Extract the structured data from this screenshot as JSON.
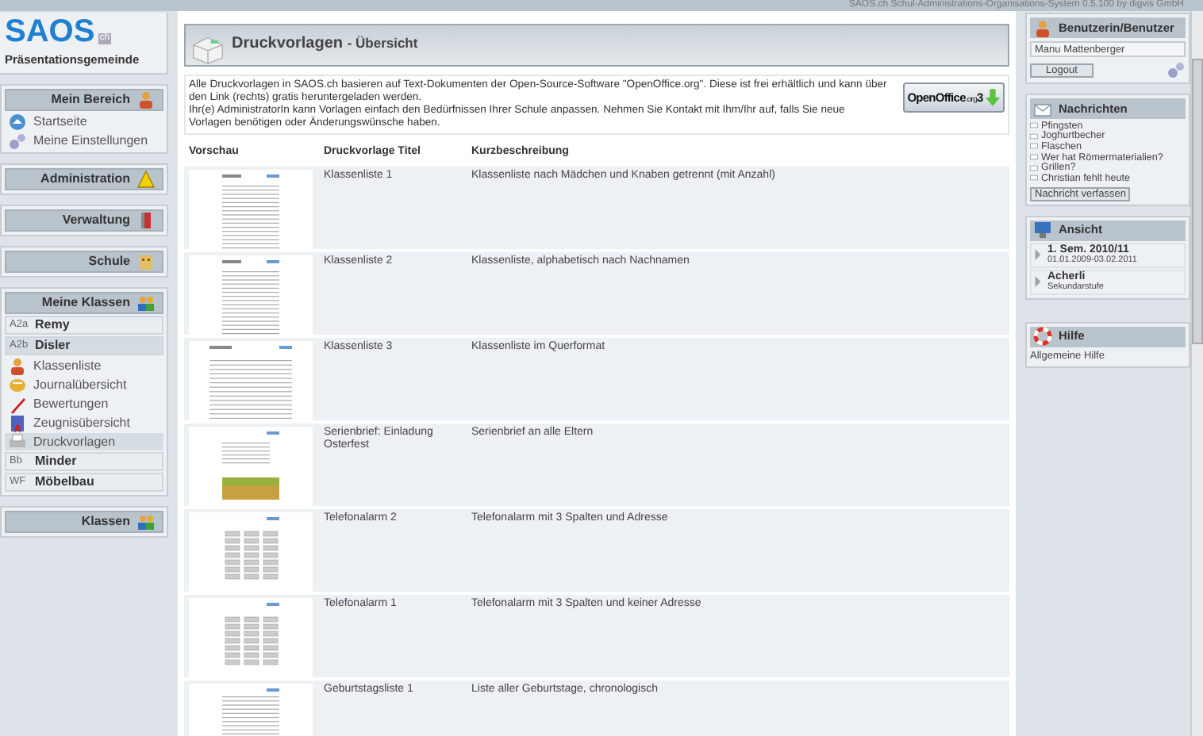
{
  "top_bar": {
    "text": "SAOS.ch Schul-Administrations-Organisations-System 0.5.100 by digvis GmbH"
  },
  "logo": {
    "name": "SAOS",
    "suffix": "ch",
    "school": "Präsentationsgemeinde"
  },
  "sidebar": {
    "sections": [
      {
        "title": "Mein Bereich",
        "items": [
          {
            "label": "Startseite"
          },
          {
            "label": "Meine Einstellungen"
          }
        ]
      },
      {
        "title": "Administration"
      },
      {
        "title": "Verwaltung"
      },
      {
        "title": "Schule"
      },
      {
        "title": "Meine Klassen",
        "classes": [
          {
            "code": "A2a",
            "name": "Remy",
            "expanded": false
          },
          {
            "code": "A2b",
            "name": "Disler",
            "expanded": true,
            "children": [
              {
                "label": "Klassenliste",
                "selected": false
              },
              {
                "label": "Journalübersicht",
                "selected": false
              },
              {
                "label": "Bewertungen",
                "selected": false
              },
              {
                "label": "Zeugnisübersicht",
                "selected": false
              },
              {
                "label": "Druckvorlagen",
                "selected": true
              }
            ]
          },
          {
            "code": "Bb",
            "name": "Minder",
            "expanded": false
          },
          {
            "code": "WF",
            "name": "Möbelbau",
            "expanded": false
          }
        ]
      },
      {
        "title": "Klassen"
      }
    ]
  },
  "page": {
    "title": "Druckvorlagen",
    "subtitle": "- Übersicht",
    "intro": [
      "Alle Druckvorlagen in SAOS.ch basieren auf Text-Dokumenten der Open-Source-Software \"OpenOffice.org\". Diese ist frei erhältlich und kann über den Link (rechts) gratis heruntergeladen werden.",
      "Ihr(e) AdministratorIn kann Vorlagen einfach den Bedürfnissen Ihrer Schule anpassen. Nehmen Sie Kontakt mit Ihm/Ihr auf, falls Sie neue Vorlagen benötigen oder Änderungswünsche haben."
    ],
    "download": {
      "brand": "OpenOffice",
      "org": ".org",
      "version": "3"
    },
    "table": {
      "columns": [
        "Vorschau",
        "Druckvorlage Titel",
        "Kurzbeschreibung"
      ],
      "rows": [
        {
          "kind": "table",
          "title": "Klassenliste 1",
          "description": "Klassenliste nach Mädchen und Knaben getrennt (mit Anzahl)"
        },
        {
          "kind": "table",
          "title": "Klassenliste 2",
          "description": "Klassenliste, alphabetisch nach Nachnamen"
        },
        {
          "kind": "wide",
          "title": "Klassenliste 3",
          "description": "Klassenliste im Querformat"
        },
        {
          "kind": "letter",
          "title": "Serienbrief: Einladung Osterfest",
          "description": "Serienbrief an alle Eltern"
        },
        {
          "kind": "phone",
          "title": "Telefonalarm 2",
          "description": "Telefonalarm mit 3 Spalten und Adresse"
        },
        {
          "kind": "phone",
          "title": "Telefonalarm 1",
          "description": "Telefonalarm mit 3 Spalten und keiner Adresse"
        },
        {
          "kind": "list",
          "title": "Geburtstagsliste 1",
          "description": "Liste aller Geburtstage, chronologisch"
        }
      ]
    }
  },
  "right": {
    "user": {
      "title": "Benutzerin/Benutzer",
      "name": "Manu Mattenberger",
      "logout": "Logout"
    },
    "messages": {
      "title": "Nachrichten",
      "items": [
        "Pfingsten",
        "Joghurtbecher",
        "Flaschen",
        "Wer hat Römermaterialien?",
        "Grillen?",
        "Christian fehlt heute"
      ],
      "compose": "Nachricht verfassen"
    },
    "view": {
      "title": "Ansicht",
      "items": [
        {
          "main": "1. Sem. 2010/11",
          "sub": "01.01.2009-03.02.2011"
        },
        {
          "main": "Acherli",
          "sub": "Sekundarstufe"
        }
      ]
    },
    "help": {
      "title": "Hilfe",
      "items": [
        "Allgemeine Hilfe"
      ]
    }
  }
}
